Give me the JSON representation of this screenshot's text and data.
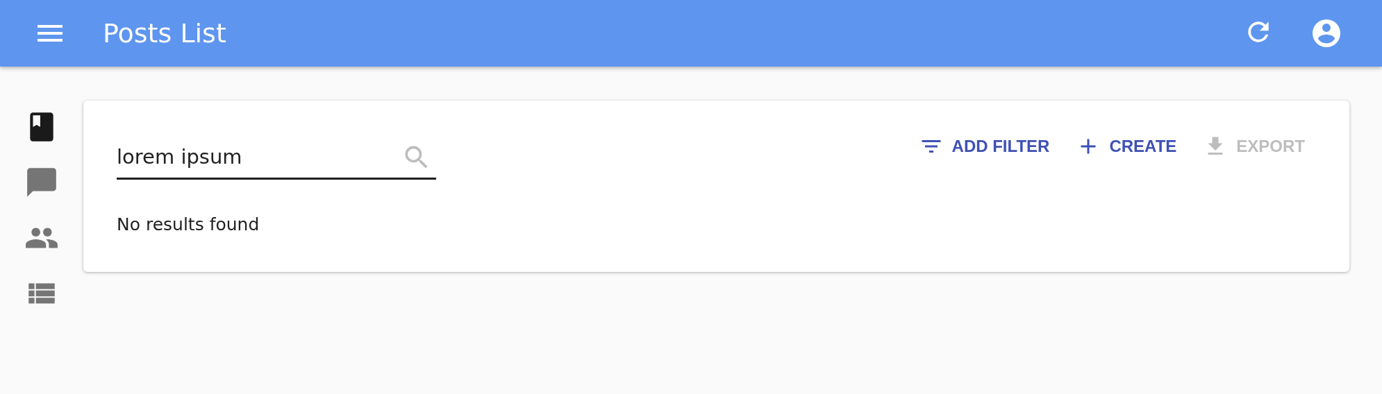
{
  "app_bar": {
    "title": "Posts List"
  },
  "sidebar": {
    "items": [
      {
        "kind": "book",
        "selected": true
      },
      {
        "kind": "comment",
        "selected": false
      },
      {
        "kind": "people",
        "selected": false
      },
      {
        "kind": "list",
        "selected": false
      }
    ]
  },
  "search": {
    "value": "lorem ipsum"
  },
  "actions": [
    {
      "kind": "filter",
      "label": "ADD FILTER",
      "disabled": false
    },
    {
      "kind": "add",
      "label": "CREATE",
      "disabled": false
    },
    {
      "kind": "download",
      "label": "EXPORT",
      "disabled": true
    }
  ],
  "message": "No results found"
}
